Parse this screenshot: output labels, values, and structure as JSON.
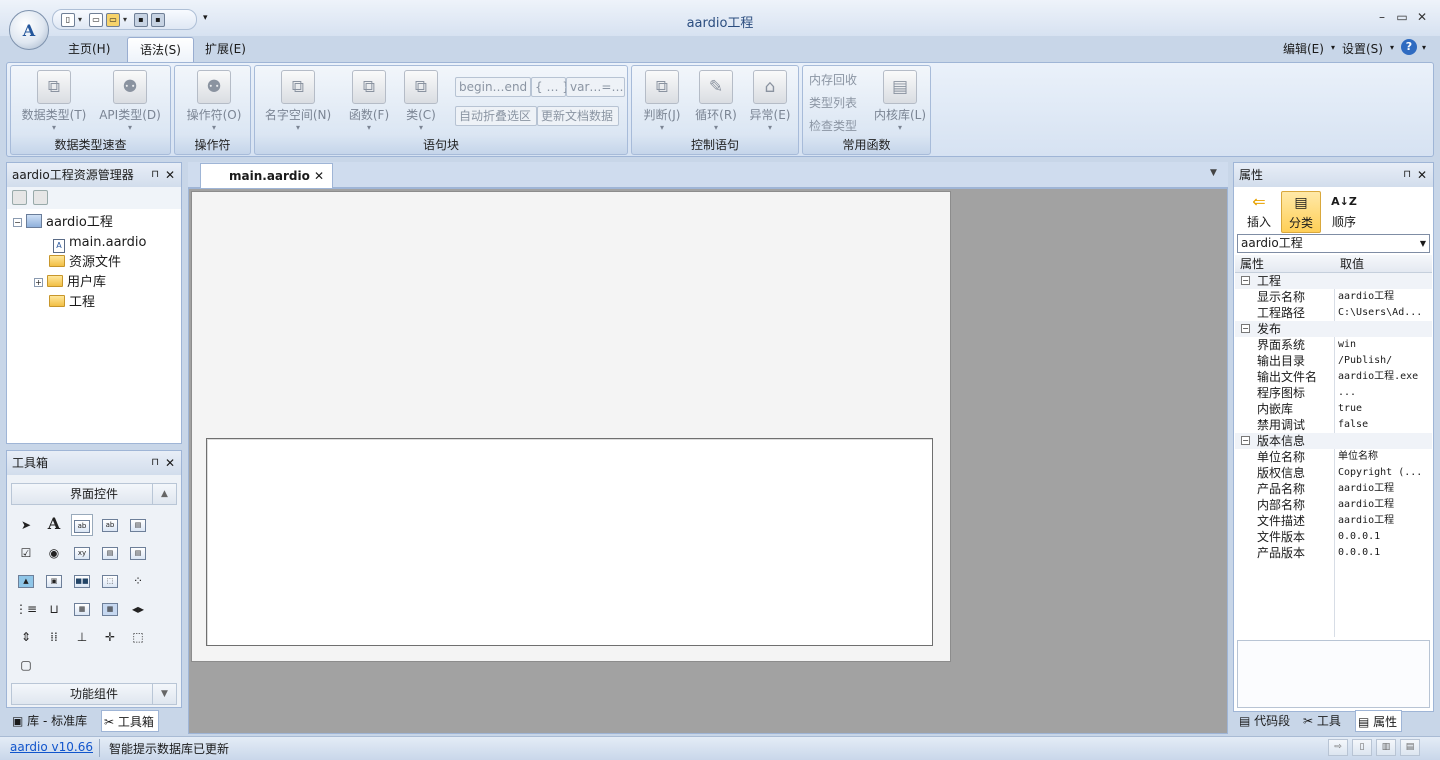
{
  "window": {
    "title": "aardio工程",
    "logo": "A"
  },
  "ribbon": {
    "tabs": [
      {
        "label": "主页(H)"
      },
      {
        "label": "语法(S)"
      },
      {
        "label": "扩展(E)"
      }
    ],
    "menu_edit": "编辑(E)",
    "menu_settings": "设置(S)",
    "groups": {
      "datatypes": {
        "caption": "数据类型速查",
        "btn1": "数据类型(T)",
        "btn2": "API类型(D)"
      },
      "operators": {
        "caption": "操作符",
        "btn1": "操作符(O)"
      },
      "statements": {
        "caption": "语句块",
        "btn1": "名字空间(N)",
        "btn2": "函数(F)",
        "btn3": "类(C)",
        "s1": "begin…end",
        "s2": "{ … }",
        "s3": "var…=…",
        "s4": "自动折叠选区",
        "s5": "更新文档数据"
      },
      "control": {
        "caption": "控制语句",
        "btn1": "判断(J)",
        "btn2": "循环(R)",
        "btn3": "异常(E)"
      },
      "common": {
        "caption": "常用函数",
        "t1": "内存回收",
        "t2": "类型列表",
        "t3": "检查类型",
        "btn1": "内核库(L)"
      }
    }
  },
  "explorer": {
    "title": "aardio工程资源管理器",
    "tree": {
      "root": "aardio工程",
      "file": "main.aardio",
      "res": "资源文件",
      "lib": "用户库",
      "proj": "工程"
    }
  },
  "toolbox": {
    "title": "工具箱",
    "section1": "界面控件",
    "section2": "功能组件"
  },
  "left_tabs": {
    "lib": "库 - 标准库",
    "toolbox": "工具箱"
  },
  "document": {
    "tab": "main.aardio"
  },
  "properties": {
    "title": "属性",
    "btn_insert": "插入",
    "btn_category": "分类",
    "btn_order": "顺序",
    "object": "aardio工程",
    "col_name": "属性",
    "col_value": "取值",
    "cats": {
      "project": "工程",
      "publish": "发布",
      "version": "版本信息"
    },
    "rows": {
      "display_name": {
        "name": "显示名称",
        "value": "aardio工程"
      },
      "proj_path": {
        "name": "工程路径",
        "value": "C:\\Users\\Ad..."
      },
      "ui": {
        "name": "界面系统",
        "value": "win"
      },
      "out_dir": {
        "name": "输出目录",
        "value": "/Publish/"
      },
      "out_file": {
        "name": "输出文件名",
        "value": "aardio工程.exe"
      },
      "icon": {
        "name": "程序图标",
        "value": "..."
      },
      "embed": {
        "name": "内嵌库",
        "value": "true"
      },
      "nodebug": {
        "name": "禁用调试",
        "value": "false"
      },
      "company": {
        "name": "单位名称",
        "value": "单位名称"
      },
      "copyright": {
        "name": "版权信息",
        "value": "Copyright (..."
      },
      "product": {
        "name": "产品名称",
        "value": "aardio工程"
      },
      "internal": {
        "name": "内部名称",
        "value": "aardio工程"
      },
      "desc": {
        "name": "文件描述",
        "value": "aardio工程"
      },
      "filever": {
        "name": "文件版本",
        "value": "0.0.0.1"
      },
      "prodver": {
        "name": "产品版本",
        "value": "0.0.0.1"
      }
    }
  },
  "right_tabs": {
    "snippets": "代码段",
    "tools": "工具",
    "props": "属性"
  },
  "status": {
    "version": "aardio v10.66",
    "message": "智能提示数据库已更新"
  }
}
